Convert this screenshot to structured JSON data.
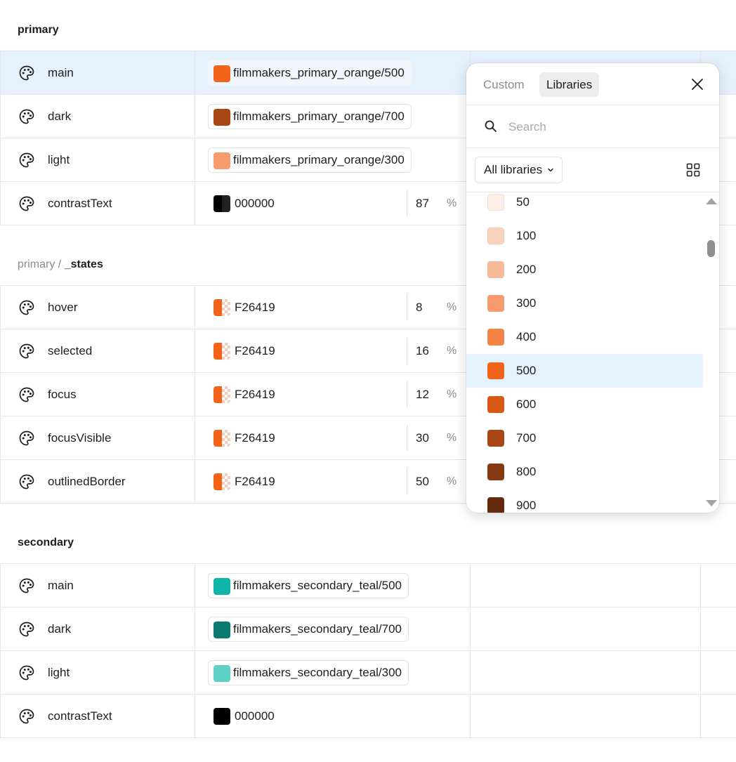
{
  "sections": [
    {
      "title_prefix": "",
      "title": "primary",
      "rows": [
        {
          "name": "main",
          "kind": "token",
          "token": "filmmakers_primary_orange/500",
          "color": "#F26419",
          "selected": true
        },
        {
          "name": "dark",
          "kind": "token",
          "token": "filmmakers_primary_orange/700",
          "color": "#A84714"
        },
        {
          "name": "light",
          "kind": "token",
          "token": "filmmakers_primary_orange/300",
          "color": "#F59B6C"
        },
        {
          "name": "contrastText",
          "kind": "value",
          "value": "000000",
          "color": "#000000",
          "opacity": "87",
          "pct": "%"
        }
      ]
    },
    {
      "title_prefix": "primary /",
      "title": "_states",
      "rows": [
        {
          "name": "hover",
          "kind": "value",
          "value": "F26419",
          "color": "#F26419",
          "opacity": "8",
          "pct": "%"
        },
        {
          "name": "selected",
          "kind": "value",
          "value": "F26419",
          "color": "#F26419",
          "opacity": "16",
          "pct": "%"
        },
        {
          "name": "focus",
          "kind": "value",
          "value": "F26419",
          "color": "#F26419",
          "opacity": "12",
          "pct": "%"
        },
        {
          "name": "focusVisible",
          "kind": "value",
          "value": "F26419",
          "color": "#F26419",
          "opacity": "30",
          "pct": "%"
        },
        {
          "name": "outlinedBorder",
          "kind": "value",
          "value": "F26419",
          "color": "#F26419",
          "opacity": "50",
          "pct": "%"
        }
      ]
    },
    {
      "title_prefix": "",
      "title": "secondary",
      "rows": [
        {
          "name": "main",
          "kind": "token",
          "token": "filmmakers_secondary_teal/500",
          "color": "#0FB5A8"
        },
        {
          "name": "dark",
          "kind": "token",
          "token": "filmmakers_secondary_teal/700",
          "color": "#0A7A72"
        },
        {
          "name": "light",
          "kind": "token",
          "token": "filmmakers_secondary_teal/300",
          "color": "#5DD0C6"
        },
        {
          "name": "contrastText",
          "kind": "value",
          "value": "000000",
          "color": "#000000",
          "opacity": "",
          "pct": ""
        }
      ]
    }
  ],
  "picker": {
    "tabs": {
      "custom": "Custom",
      "libraries": "Libraries"
    },
    "active_tab": "Libraries",
    "search": {
      "placeholder": "Search",
      "value": ""
    },
    "filter_label": "All libraries",
    "items": [
      {
        "label": "50",
        "color": "#FDEEE6"
      },
      {
        "label": "100",
        "color": "#FBD4C0"
      },
      {
        "label": "200",
        "color": "#F7BA98"
      },
      {
        "label": "300",
        "color": "#F59B6C"
      },
      {
        "label": "400",
        "color": "#F38447"
      },
      {
        "label": "500",
        "color": "#F26419",
        "selected": true
      },
      {
        "label": "600",
        "color": "#D95716"
      },
      {
        "label": "700",
        "color": "#A84714"
      },
      {
        "label": "800",
        "color": "#873A12"
      },
      {
        "label": "900",
        "color": "#642A0D"
      }
    ]
  }
}
